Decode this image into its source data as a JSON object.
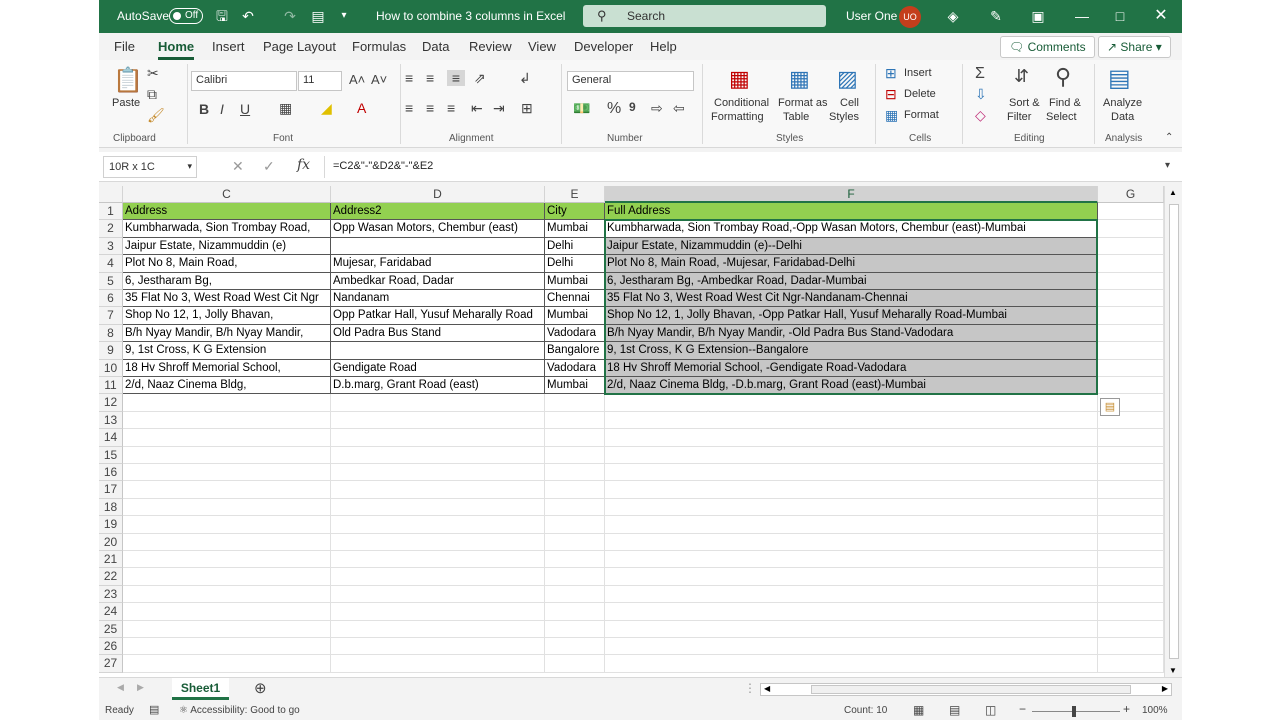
{
  "titlebar": {
    "autosave_label": "AutoSave",
    "autosave_state": "Off",
    "doc_title": "How to combine 3 columns in Excel",
    "search_placeholder": "Search",
    "user_name": "User One",
    "user_initials": "UO"
  },
  "menu": {
    "items": [
      "File",
      "Home",
      "Insert",
      "Page Layout",
      "Formulas",
      "Data",
      "Review",
      "View",
      "Developer",
      "Help"
    ],
    "active": "Home",
    "comments_label": "Comments",
    "share_label": "Share"
  },
  "ribbon": {
    "clipboard": {
      "paste": "Paste",
      "label": "Clipboard"
    },
    "font": {
      "name": "Calibri",
      "size": "11",
      "label": "Font"
    },
    "alignment": {
      "label": "Alignment"
    },
    "number": {
      "format": "General",
      "label": "Number"
    },
    "styles": {
      "conditional_1": "Conditional",
      "conditional_2": "Formatting",
      "format_table_1": "Format as",
      "format_table_2": "Table",
      "cell_styles_1": "Cell",
      "cell_styles_2": "Styles",
      "label": "Styles"
    },
    "cells": {
      "insert": "Insert",
      "delete": "Delete",
      "format": "Format",
      "label": "Cells"
    },
    "editing": {
      "sort_1": "Sort &",
      "sort_2": "Filter",
      "find_1": "Find &",
      "find_2": "Select",
      "label": "Editing"
    },
    "analysis": {
      "analyze_1": "Analyze",
      "analyze_2": "Data",
      "label": "Analysis"
    }
  },
  "formula_bar": {
    "name_box": "10R x 1C",
    "formula": "=C2&\"-\"&D2&\"-\"&E2"
  },
  "sheet": {
    "columns": [
      "C",
      "D",
      "E",
      "F",
      "G"
    ],
    "selected_column": "F",
    "rows": [
      [
        "Address",
        "Address2",
        "City",
        "Full Address"
      ],
      [
        "Kumbharwada, Sion Trombay Road,",
        "Opp Wasan Motors, Chembur (east)",
        "Mumbai",
        "Kumbharwada, Sion Trombay Road,-Opp Wasan Motors, Chembur (east)-Mumbai"
      ],
      [
        "Jaipur Estate, Nizammuddin (e)",
        "",
        "Delhi",
        "Jaipur Estate, Nizammuddin (e)--Delhi"
      ],
      [
        "Plot No 8, Main Road,",
        "Mujesar, Faridabad",
        "Delhi",
        "Plot No 8, Main Road, -Mujesar, Faridabad-Delhi"
      ],
      [
        "6, Jestharam Bg,",
        "Ambedkar Road, Dadar",
        "Mumbai",
        "6, Jestharam Bg, -Ambedkar Road, Dadar-Mumbai"
      ],
      [
        "35 Flat No 3, West Road West Cit Ngr",
        "Nandanam",
        "Chennai",
        "35 Flat No 3, West Road West Cit Ngr-Nandanam-Chennai"
      ],
      [
        "Shop No 12, 1, Jolly Bhavan,",
        "Opp Patkar Hall, Yusuf Meharally Road",
        "Mumbai",
        "Shop No 12, 1, Jolly Bhavan, -Opp Patkar Hall, Yusuf Meharally Road-Mumbai"
      ],
      [
        "B/h Nyay Mandir, B/h Nyay Mandir,",
        "Old Padra Bus Stand",
        "Vadodara",
        "B/h Nyay Mandir, B/h Nyay Mandir, -Old Padra Bus Stand-Vadodara"
      ],
      [
        "9, 1st Cross, K G Extension",
        "",
        "Bangalore",
        "9, 1st Cross, K G Extension--Bangalore"
      ],
      [
        "18 Hv Shroff Memorial School,",
        "Gendigate Road",
        "Vadodara",
        "18 Hv Shroff Memorial School, -Gendigate Road-Vadodara"
      ],
      [
        "2/d, Naaz Cinema Bldg,",
        "D.b.marg, Grant Road (east)",
        "Mumbai",
        "2/d, Naaz Cinema Bldg, -D.b.marg, Grant Road (east)-Mumbai"
      ]
    ],
    "row_numbers": [
      "1",
      "2",
      "3",
      "4",
      "5",
      "6",
      "7",
      "8",
      "9",
      "10",
      "11",
      "12",
      "13",
      "14",
      "15",
      "16",
      "17",
      "18",
      "19",
      "20",
      "21",
      "22",
      "23",
      "24",
      "25",
      "26",
      "27"
    ]
  },
  "sheet_tabs": {
    "active": "Sheet1"
  },
  "status": {
    "ready": "Ready",
    "accessibility": "Accessibility: Good to go",
    "count": "Count: 10",
    "zoom": "100%"
  },
  "colors": {
    "excel_green": "#217346",
    "header_fill": "#92d050",
    "selection": "#c6c6c6"
  }
}
